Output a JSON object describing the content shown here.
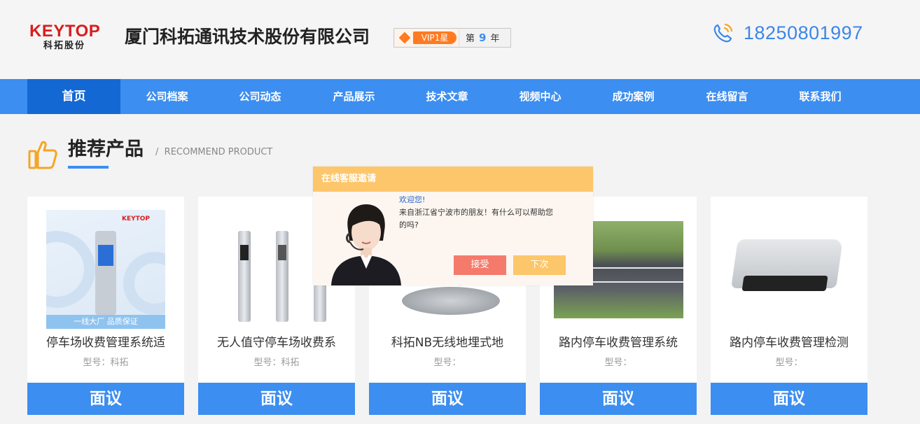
{
  "header": {
    "logo_en": "KEYTOP",
    "logo_cn": "科拓股份",
    "company_name": "厦门科拓通讯技术股份有限公司",
    "vip_label": "VIP1星",
    "years_prefix": "第",
    "years_value": "9",
    "years_suffix": "年",
    "phone": "18250801997",
    "phone_icon": "phone-icon"
  },
  "nav": {
    "items": [
      "首页",
      "公司档案",
      "公司动态",
      "产品展示",
      "技术文章",
      "视频中心",
      "成功案例",
      "在线留言",
      "联系我们"
    ],
    "active_index": 0
  },
  "section": {
    "icon": "thumbs-up-icon",
    "title": "推荐产品",
    "separator": "/",
    "subtitle": "RECOMMEND PRODUCT"
  },
  "products": [
    {
      "name": "停车场收费管理系统适",
      "model": "型号：科拓",
      "price": "面议",
      "img_tag": "KEYTOP",
      "img_slogan": "一线大厂  品质保证"
    },
    {
      "name": "无人值守停车场收费系",
      "model": "型号：科拓",
      "price": "面议"
    },
    {
      "name": "科拓NB无线地埋式地",
      "model": "型号：",
      "price": "面议"
    },
    {
      "name": "路内停车收费管理系统",
      "model": "型号：",
      "price": "面议"
    },
    {
      "name": "路内停车收费管理检测",
      "model": "型号：",
      "price": "面议"
    }
  ],
  "popup": {
    "title": "在线客服邀请",
    "welcome": "欢迎您!",
    "message": "来自浙江省宁波市的朋友！有什么可以帮助您的吗?",
    "accept": "接受",
    "later": "下次"
  },
  "colors": {
    "nav_bg": "#3c8ef0",
    "nav_active": "#1468d4",
    "brand_red": "#d81e1e",
    "phone_blue": "#3c86e8",
    "popup_header": "#fec66a",
    "accept_btn": "#f47a6c",
    "later_btn": "#fcc66a"
  }
}
